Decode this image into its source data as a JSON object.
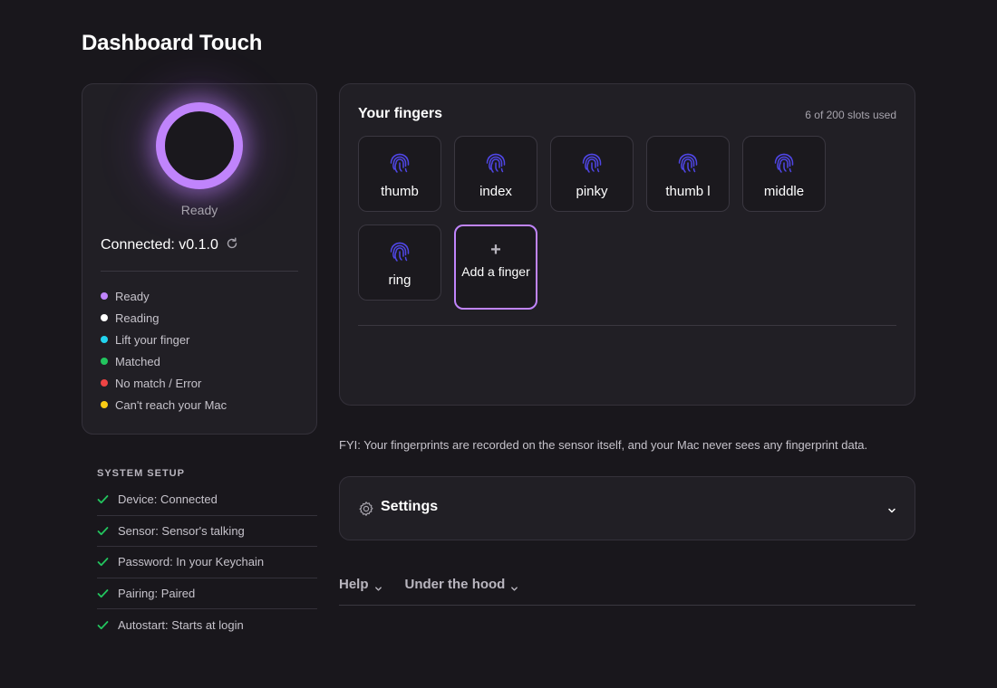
{
  "app": {
    "title": "Dashboard Touch"
  },
  "status_card": {
    "ring_status": "Ready",
    "ring_color": "#c084fc",
    "connected_label": "Connected: v0.1.0",
    "refresh_icon": "refresh-icon",
    "legend": [
      {
        "label": "Ready",
        "color": "#c084fc"
      },
      {
        "label": "Reading",
        "color": "#ffffff"
      },
      {
        "label": "Lift your finger",
        "color": "#22d3ee"
      },
      {
        "label": "Matched",
        "color": "#22c55e"
      },
      {
        "label": "No match / Error",
        "color": "#ef4444"
      },
      {
        "label": "Can't reach your Mac",
        "color": "#facc15"
      }
    ]
  },
  "system_setup": {
    "heading": "SYSTEM SETUP",
    "check_color": "#22c55e",
    "items": [
      {
        "label": "Device: Connected"
      },
      {
        "label": "Sensor: Sensor's talking"
      },
      {
        "label": "Password: In your Keychain"
      },
      {
        "label": "Pairing: Paired"
      },
      {
        "label": "Autostart: Starts at login"
      }
    ]
  },
  "fingers": {
    "title": "Your fingers",
    "slots_used": "6 of 200 slots used",
    "icon_color": "#4f46e5",
    "items": [
      {
        "label": "thumb"
      },
      {
        "label": "index"
      },
      {
        "label": "pinky"
      },
      {
        "label": "thumb l"
      },
      {
        "label": "middle"
      },
      {
        "label": "ring"
      }
    ],
    "add_button": {
      "plus": "+",
      "label": "Add a finger"
    }
  },
  "fyi_text": "FYI: Your fingerprints are recorded on the sensor itself, and your Mac never sees any fingerprint data.",
  "settings": {
    "label": "Settings",
    "icon": "gear-icon"
  },
  "bottom_nav": [
    {
      "label": "Help"
    },
    {
      "label": "Under the hood"
    }
  ]
}
